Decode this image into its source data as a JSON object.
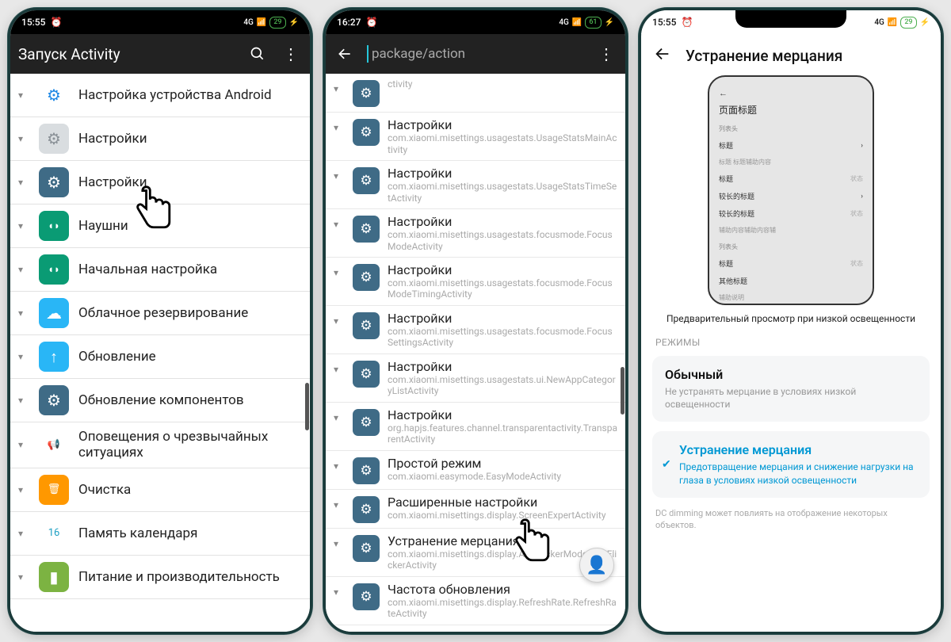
{
  "phone1": {
    "status": {
      "time": "15:55",
      "net": "4G",
      "battery": "29"
    },
    "toolbar": {
      "title": "Запуск Activity"
    },
    "rows": [
      {
        "title": "Настройка устройства Android",
        "icon_bg": "#ffffff",
        "icon_fg": "#1e88e5",
        "glyph": "⚙"
      },
      {
        "title": "Настройки",
        "icon_bg": "#d9dde0",
        "icon_fg": "#8a9197",
        "glyph": "⚙"
      },
      {
        "title": "Настройки",
        "icon_bg": "#3f6b86",
        "icon_fg": "#ffffff",
        "glyph": "⚙"
      },
      {
        "title": "Наушни",
        "icon_bg": "#0a9b74",
        "icon_fg": "#ffffff",
        "glyph": "◖◗"
      },
      {
        "title": "Начальная настройка",
        "icon_bg": "#0a9b74",
        "icon_fg": "#ffffff",
        "glyph": "◖◗"
      },
      {
        "title": "Облачное резервирование",
        "icon_bg": "#29b6f6",
        "icon_fg": "#ffffff",
        "glyph": "☁"
      },
      {
        "title": "Обновление",
        "icon_bg": "#29b6f6",
        "icon_fg": "#ffffff",
        "glyph": "↑"
      },
      {
        "title": "Обновление компонентов",
        "icon_bg": "#3f6b86",
        "icon_fg": "#ffffff",
        "glyph": "⚙"
      },
      {
        "title": "Оповещения о чрезвычайных ситуациях",
        "icon_bg": "#ffffff",
        "icon_fg": "#2196f3",
        "glyph": "📢"
      },
      {
        "title": "Очистка",
        "icon_bg": "#ff9800",
        "icon_fg": "#ffffff",
        "glyph": "🗑"
      },
      {
        "title": "Память календаря",
        "icon_bg": "#ffffff",
        "icon_fg": "#1ea0c3",
        "glyph": "16"
      },
      {
        "title": "Питание и производительность",
        "icon_bg": "#7cb342",
        "icon_fg": "#ffffff",
        "glyph": "▮"
      }
    ]
  },
  "phone2": {
    "status": {
      "time": "16:27",
      "net": "4G",
      "battery": "61"
    },
    "toolbar": {
      "placeholder": "package/action"
    },
    "rows": [
      {
        "title": "",
        "sub": "ctivity"
      },
      {
        "title": "Настройки",
        "sub": "com.xiaomi.misettings.usagestats.UsageStatsMainActivity"
      },
      {
        "title": "Настройки",
        "sub": "com.xiaomi.misettings.usagestats.UsageStatsTimeSetActivity"
      },
      {
        "title": "Настройки",
        "sub": "com.xiaomi.misettings.usagestats.focusmode.FocusModeActivity"
      },
      {
        "title": "Настройки",
        "sub": "com.xiaomi.misettings.usagestats.focusmode.FocusModeTimingActivity"
      },
      {
        "title": "Настройки",
        "sub": "com.xiaomi.misettings.usagestats.focusmode.FocusSettingsActivity"
      },
      {
        "title": "Настройки",
        "sub": "com.xiaomi.misettings.usagestats.ui.NewAppCategoryListActivity"
      },
      {
        "title": "Настройки",
        "sub": "org.hapjs.features.channel.transparentactivity.TransparentActivity"
      },
      {
        "title": "Простой режим",
        "sub": "com.xiaomi.easymode.EasyModeActivity"
      },
      {
        "title": "Расширенные настройки",
        "sub": "com.xiaomi.misettings.display.ScreenExpertActivity"
      },
      {
        "title": "Устранение мерцания",
        "sub": "com.xiaomi.misettings.display.AntiFlickerMode.AntiFlickerActivity"
      },
      {
        "title": "Частота обновления",
        "sub": "com.xiaomi.misettings.display.RefreshRate.RefreshRateActivity"
      }
    ]
  },
  "phone3": {
    "status": {
      "time": "15:55",
      "net": "4G",
      "battery": "29"
    },
    "title": "Устранение мерцания",
    "preview": {
      "head": "页面标题",
      "sec1": "列表头",
      "r1": "标题",
      "r1b": "标题 标题辅助内容",
      "r2": "标题",
      "r3": "较长的标题",
      "r4": "较长的标题",
      "r4b": "辅助内容辅助内容辅",
      "sec2": "列表头",
      "r5": "标题",
      "r6": "其他标题",
      "foot": "辅助说明"
    },
    "caption": "Предварительный просмотр при низкой освещенности",
    "section": "РЕЖИМЫ",
    "mode1": {
      "title": "Обычный",
      "desc": "Не устранять мерцание в условиях низкой освещенности"
    },
    "mode2": {
      "title": "Устранение мерцания",
      "desc": "Предотвращение мерцания и снижение нагрузки на глаза в условиях низкой освещенности"
    },
    "footnote": "DC dimming может повлиять на отображение некоторых объектов."
  }
}
